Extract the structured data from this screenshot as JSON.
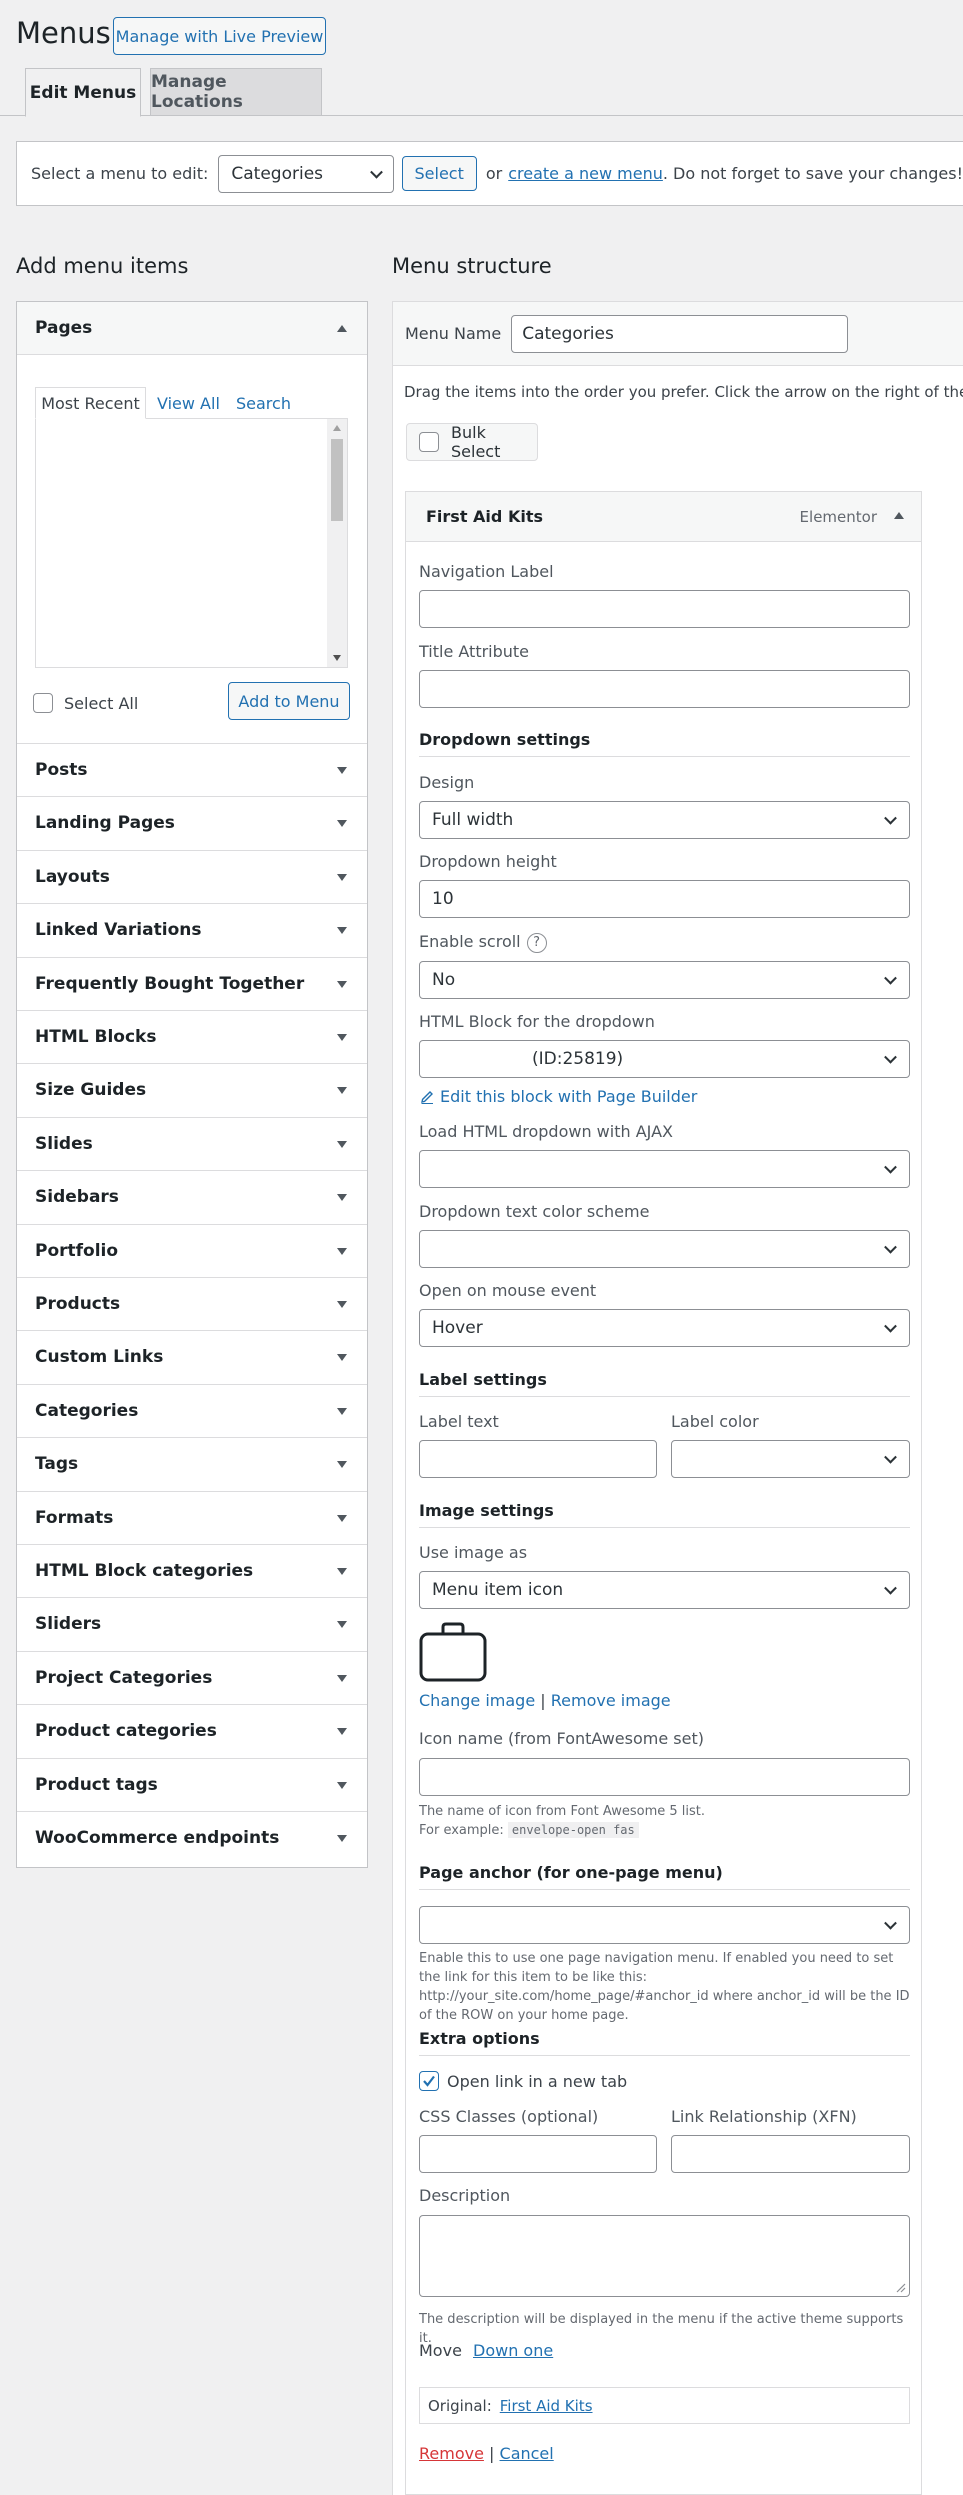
{
  "header": {
    "title": "Menus",
    "live_preview_label": "Manage with Live Preview",
    "tabs": [
      {
        "label": "Edit Menus",
        "active": true
      },
      {
        "label": "Manage Locations",
        "active": false
      }
    ]
  },
  "select_bar": {
    "prompt": "Select a menu to edit:",
    "selected_menu": "Categories",
    "select_label": "Select",
    "or_text": "or",
    "create_link": "create a new menu",
    "tail_text": ". Do not forget to save your changes!"
  },
  "left": {
    "heading": "Add menu items",
    "pages": {
      "title": "Pages",
      "tabs": [
        "Most Recent",
        "View All",
        "Search"
      ],
      "select_all_label": "Select All",
      "add_label": "Add to Menu"
    },
    "sections": [
      "Posts",
      "Landing Pages",
      "Layouts",
      "Linked Variations",
      "Frequently Bought Together",
      "HTML Blocks",
      "Size Guides",
      "Slides",
      "Sidebars",
      "Portfolio",
      "Products",
      "Custom Links",
      "Categories",
      "Tags",
      "Formats",
      "HTML Block categories",
      "Sliders",
      "Project Categories",
      "Product categories",
      "Product tags",
      "WooCommerce endpoints"
    ]
  },
  "right": {
    "heading": "Menu structure",
    "menu_name_label": "Menu Name",
    "menu_name_value": "Categories",
    "drag_text": "Drag the items into the order you prefer. Click the arrow on the right of the item to reveal additional configuration options.",
    "bulk_select_label": "Bulk Select",
    "item": {
      "title": "First Aid Kits",
      "type": "Elementor",
      "navigation_label": "Navigation Label",
      "navigation_value": "",
      "title_attribute": "Title Attribute",
      "title_attribute_value": "",
      "dropdown_settings": "Dropdown settings",
      "design_label": "Design",
      "design_value": "Full width",
      "dropdown_height_label": "Dropdown height",
      "dropdown_height_value": "10",
      "enable_scroll_label": "Enable scroll",
      "enable_scroll_help": "?",
      "enable_scroll_value": "No",
      "html_block_label": "HTML Block for the dropdown",
      "html_block_value": "(ID:25819)",
      "edit_block_link": "Edit this block with Page Builder",
      "ajax_label": "Load HTML dropdown with AJAX",
      "ajax_value": "",
      "color_scheme_label": "Dropdown text color scheme",
      "color_scheme_value": "",
      "mouse_event_label": "Open on mouse event",
      "mouse_event_value": "Hover",
      "label_settings": "Label settings",
      "label_text_label": "Label text",
      "label_text_value": "",
      "label_color_label": "Label color",
      "label_color_value": "",
      "image_settings": "Image settings",
      "use_image_label": "Use image as",
      "use_image_value": "Menu item icon",
      "change_image_link": "Change image",
      "image_separator": "|",
      "remove_image_link": "Remove image",
      "icon_name_label": "Icon name (from FontAwesome set)",
      "icon_name_value": "",
      "icon_help_1": "The name of icon from Font Awesome 5 list.",
      "icon_help_2_prefix": "For example:",
      "icon_help_2_code": "envelope-open fas",
      "page_anchor": "Page anchor (for one-page menu)",
      "page_anchor_value": "",
      "anchor_help": "Enable this to use one page navigation menu. If enabled you need to set the link for this item to be like this: http://your_site.com/home_page/#anchor_id where anchor_id will be the ID of the ROW on your home page.",
      "extra_options": "Extra options",
      "open_new_tab_label": "Open link in a new tab",
      "open_new_tab_checked": true,
      "css_classes_label": "CSS Classes (optional)",
      "css_classes_value": "",
      "xfn_label": "Link Relationship (XFN)",
      "xfn_value": "",
      "description_label": "Description",
      "description_value": "",
      "description_help": "The description will be displayed in the menu if the active theme supports it.",
      "move_label": "Move",
      "move_down_link": "Down one",
      "original_label": "Original:",
      "original_link": "First Aid Kits",
      "remove_link": "Remove",
      "cancel_separator": "|",
      "cancel_link": "Cancel"
    }
  },
  "colors": {
    "accent": "#2271b1",
    "danger": "#d63638",
    "background": "#f0f0f1"
  }
}
